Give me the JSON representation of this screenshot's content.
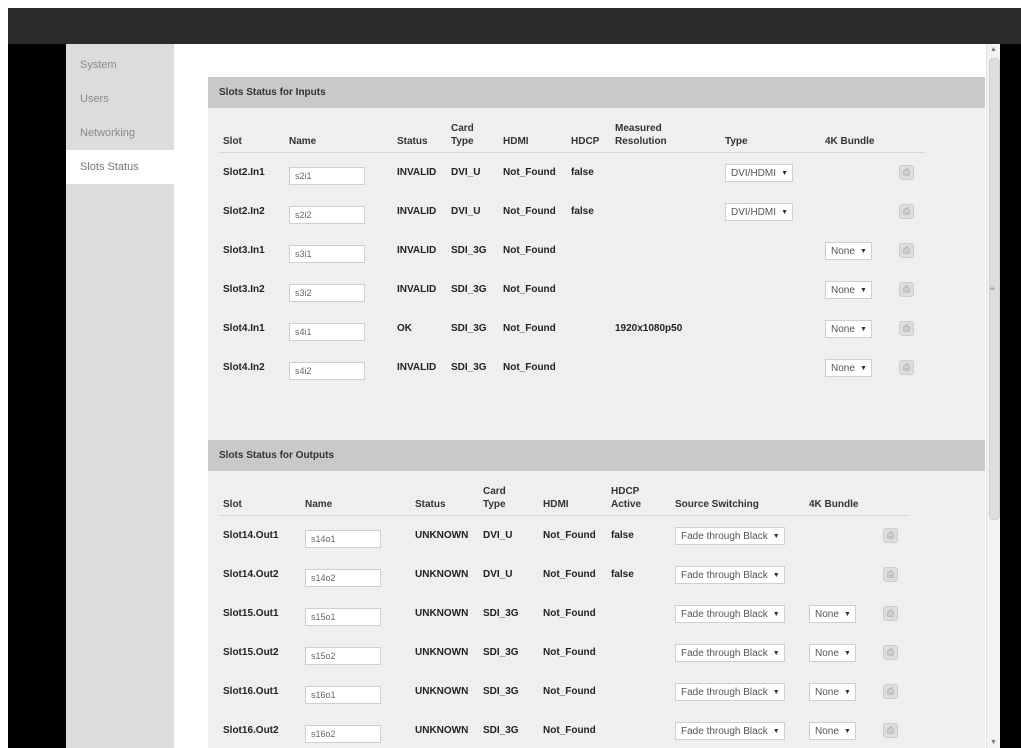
{
  "sidebar": {
    "items": [
      {
        "label": "System"
      },
      {
        "label": "Users"
      },
      {
        "label": "Networking"
      },
      {
        "label": "Slots Status",
        "active": true
      }
    ]
  },
  "inputs": {
    "title": "Slots Status for Inputs",
    "headers": {
      "slot": "Slot",
      "name": "Name",
      "status": "Status",
      "card_type_l1": "Card",
      "card_type_l2": "Type",
      "hdmi": "HDMI",
      "hdcp": "HDCP",
      "measured_l1": "Measured",
      "measured_l2": "Resolution",
      "type": "Type",
      "bundle": "4K Bundle"
    },
    "rows": [
      {
        "slot": "Slot2.In1",
        "name": "s2i1",
        "status": "INVALID",
        "card_type": "DVI_U",
        "hdmi": "Not_Found",
        "hdcp": "false",
        "resolution": "",
        "type": "DVI/HDMI",
        "bundle": ""
      },
      {
        "slot": "Slot2.In2",
        "name": "s2i2",
        "status": "INVALID",
        "card_type": "DVI_U",
        "hdmi": "Not_Found",
        "hdcp": "false",
        "resolution": "",
        "type": "DVI/HDMI",
        "bundle": ""
      },
      {
        "slot": "Slot3.In1",
        "name": "s3i1",
        "status": "INVALID",
        "card_type": "SDI_3G",
        "hdmi": "Not_Found",
        "hdcp": "",
        "resolution": "",
        "type": "",
        "bundle": "None"
      },
      {
        "slot": "Slot3.In2",
        "name": "s3i2",
        "status": "INVALID",
        "card_type": "SDI_3G",
        "hdmi": "Not_Found",
        "hdcp": "",
        "resolution": "",
        "type": "",
        "bundle": "None"
      },
      {
        "slot": "Slot4.In1",
        "name": "s4i1",
        "status": "OK",
        "card_type": "SDI_3G",
        "hdmi": "Not_Found",
        "hdcp": "",
        "resolution": "1920x1080p50",
        "type": "",
        "bundle": "None"
      },
      {
        "slot": "Slot4.In2",
        "name": "s4i2",
        "status": "INVALID",
        "card_type": "SDI_3G",
        "hdmi": "Not_Found",
        "hdcp": "",
        "resolution": "",
        "type": "",
        "bundle": "None"
      }
    ]
  },
  "outputs": {
    "title": "Slots Status for Outputs",
    "headers": {
      "slot": "Slot",
      "name": "Name",
      "status": "Status",
      "card_type_l1": "Card",
      "card_type_l2": "Type",
      "hdmi": "HDMI",
      "hdcp_l1": "HDCP",
      "hdcp_l2": "Active",
      "source": "Source Switching",
      "bundle": "4K Bundle"
    },
    "rows": [
      {
        "slot": "Slot14.Out1",
        "name": "s14o1",
        "status": "UNKNOWN",
        "card_type": "DVI_U",
        "hdmi": "Not_Found",
        "hdcp": "false",
        "source": "Fade through Black",
        "bundle": ""
      },
      {
        "slot": "Slot14.Out2",
        "name": "s14o2",
        "status": "UNKNOWN",
        "card_type": "DVI_U",
        "hdmi": "Not_Found",
        "hdcp": "false",
        "source": "Fade through Black",
        "bundle": ""
      },
      {
        "slot": "Slot15.Out1",
        "name": "s15o1",
        "status": "UNKNOWN",
        "card_type": "SDI_3G",
        "hdmi": "Not_Found",
        "hdcp": "",
        "source": "Fade through Black",
        "bundle": "None"
      },
      {
        "slot": "Slot15.Out2",
        "name": "s15o2",
        "status": "UNKNOWN",
        "card_type": "SDI_3G",
        "hdmi": "Not_Found",
        "hdcp": "",
        "source": "Fade through Black",
        "bundle": "None"
      },
      {
        "slot": "Slot16.Out1",
        "name": "s16o1",
        "status": "UNKNOWN",
        "card_type": "SDI_3G",
        "hdmi": "Not_Found",
        "hdcp": "",
        "source": "Fade through Black",
        "bundle": "None"
      },
      {
        "slot": "Slot16.Out2",
        "name": "s16o2",
        "status": "UNKNOWN",
        "card_type": "SDI_3G",
        "hdmi": "Not_Found",
        "hdcp": "",
        "source": "Fade through Black",
        "bundle": "None"
      }
    ]
  },
  "icons": {
    "row_action": "save-icon",
    "caret": "chevron-down-icon"
  },
  "colors": {
    "topbar": "#2b2b2b",
    "sidebar": "#dcdcdc",
    "panel_header": "#c9c9c9",
    "panel_body": "#efefef"
  }
}
